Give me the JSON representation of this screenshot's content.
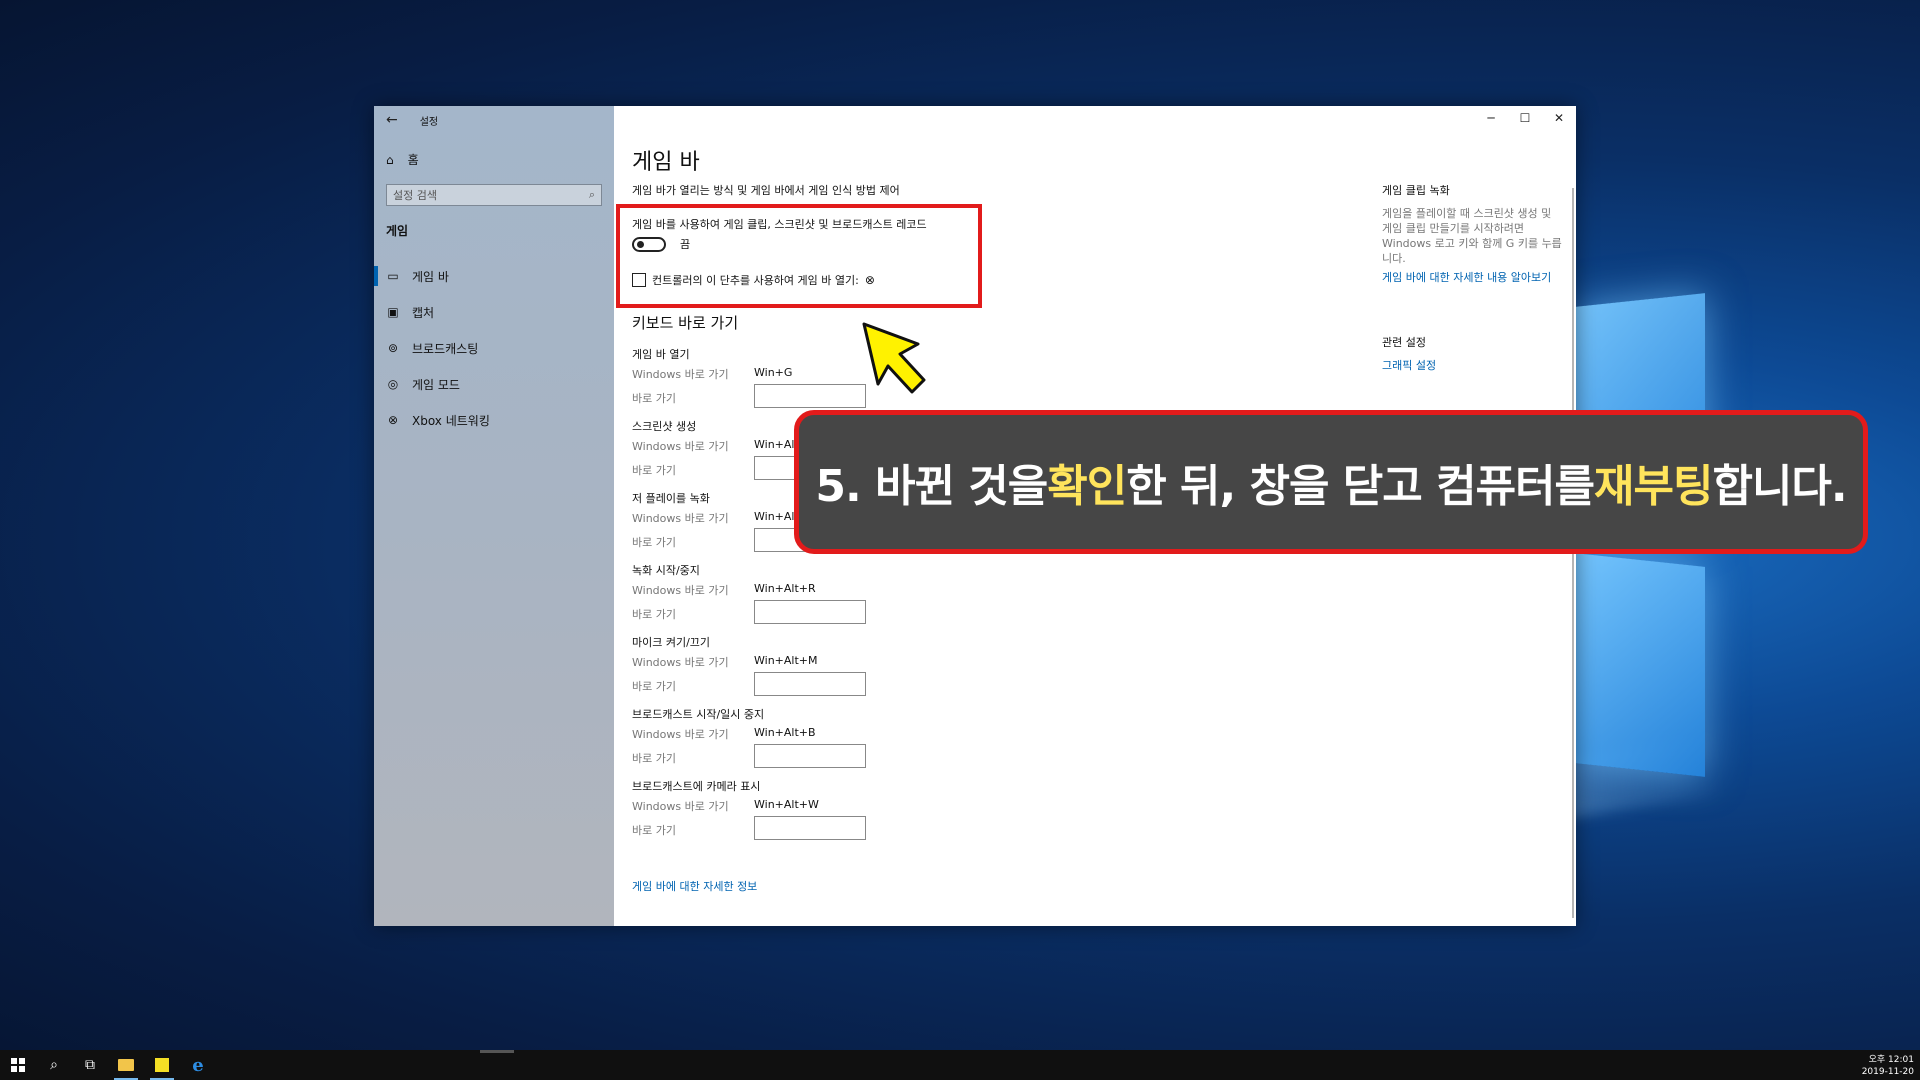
{
  "window": {
    "app_title": "설정",
    "controls": {
      "minimize": "─",
      "maximize": "☐",
      "close": "✕"
    }
  },
  "sidebar": {
    "back_icon": "←",
    "home": "홈",
    "search_placeholder": "설정 검색",
    "section": "게임",
    "items": [
      {
        "label": "게임 바",
        "icon": "game-bar-icon",
        "glyph": "▭",
        "active": true
      },
      {
        "label": "캡처",
        "icon": "capture-icon",
        "glyph": "▣",
        "active": false
      },
      {
        "label": "브로드캐스팅",
        "icon": "broadcast-icon",
        "glyph": "⊚",
        "active": false
      },
      {
        "label": "게임 모드",
        "icon": "game-mode-icon",
        "glyph": "◎",
        "active": false
      },
      {
        "label": "Xbox 네트워킹",
        "icon": "xbox-icon",
        "glyph": "⊗",
        "active": false
      }
    ]
  },
  "main": {
    "title": "게임 바",
    "description": "게임 바가 열리는 방식 및 게임 바에서 게임 인식 방법 제어",
    "record_label": "게임 바를 사용하여 게임 클립, 스크린샷 및 브로드캐스트 레코드",
    "toggle_state": "끔",
    "controller_label": "컨트롤러의 이 단추를 사용하여 게임 바 열기:",
    "keyboard_title": "키보드 바로 가기",
    "windows_shortcut_label": "Windows 바로 가기",
    "alt_shortcut_label": "바로 가기",
    "shortcuts": [
      {
        "name": "게임 바 열기",
        "value": "Win+G"
      },
      {
        "name": "스크린샷 생성",
        "value": "Win+Alt"
      },
      {
        "name": "저 플레이를 녹화",
        "value": "Win+Alt"
      },
      {
        "name": "녹화 시작/중지",
        "value": "Win+Alt+R"
      },
      {
        "name": "마이크 켜기/끄기",
        "value": "Win+Alt+M"
      },
      {
        "name": "브로드캐스트 시작/일시 중지",
        "value": "Win+Alt+B"
      },
      {
        "name": "브로드캐스트에 카메라 표시",
        "value": "Win+Alt+W"
      }
    ],
    "more_info_link": "게임 바에 대한 자세한 정보"
  },
  "right": {
    "clip_title": "게임 클립 녹화",
    "clip_body": "게임을 플레이할 때 스크린샷 생성 및 게임 클립 만들기를 시작하려면 Windows 로고 키와 함께 G 키를 누릅니다.",
    "clip_link": "게임 바에 대한 자세한 내용 알아보기",
    "related_title": "관련 설정",
    "related_link": "그래픽 설정"
  },
  "callout": {
    "part1": "5. 바뀐 것을 ",
    "highlight1": "확인",
    "part2": "한 뒤, 창을 닫고 컴퓨터를 ",
    "highlight2": "재부팅",
    "part3": "합니다.",
    "highlight_color": "#ffe45c",
    "border_color": "#e21b1b"
  },
  "taskbar": {
    "time": "오후 12:01",
    "date": "2019-11-20"
  }
}
